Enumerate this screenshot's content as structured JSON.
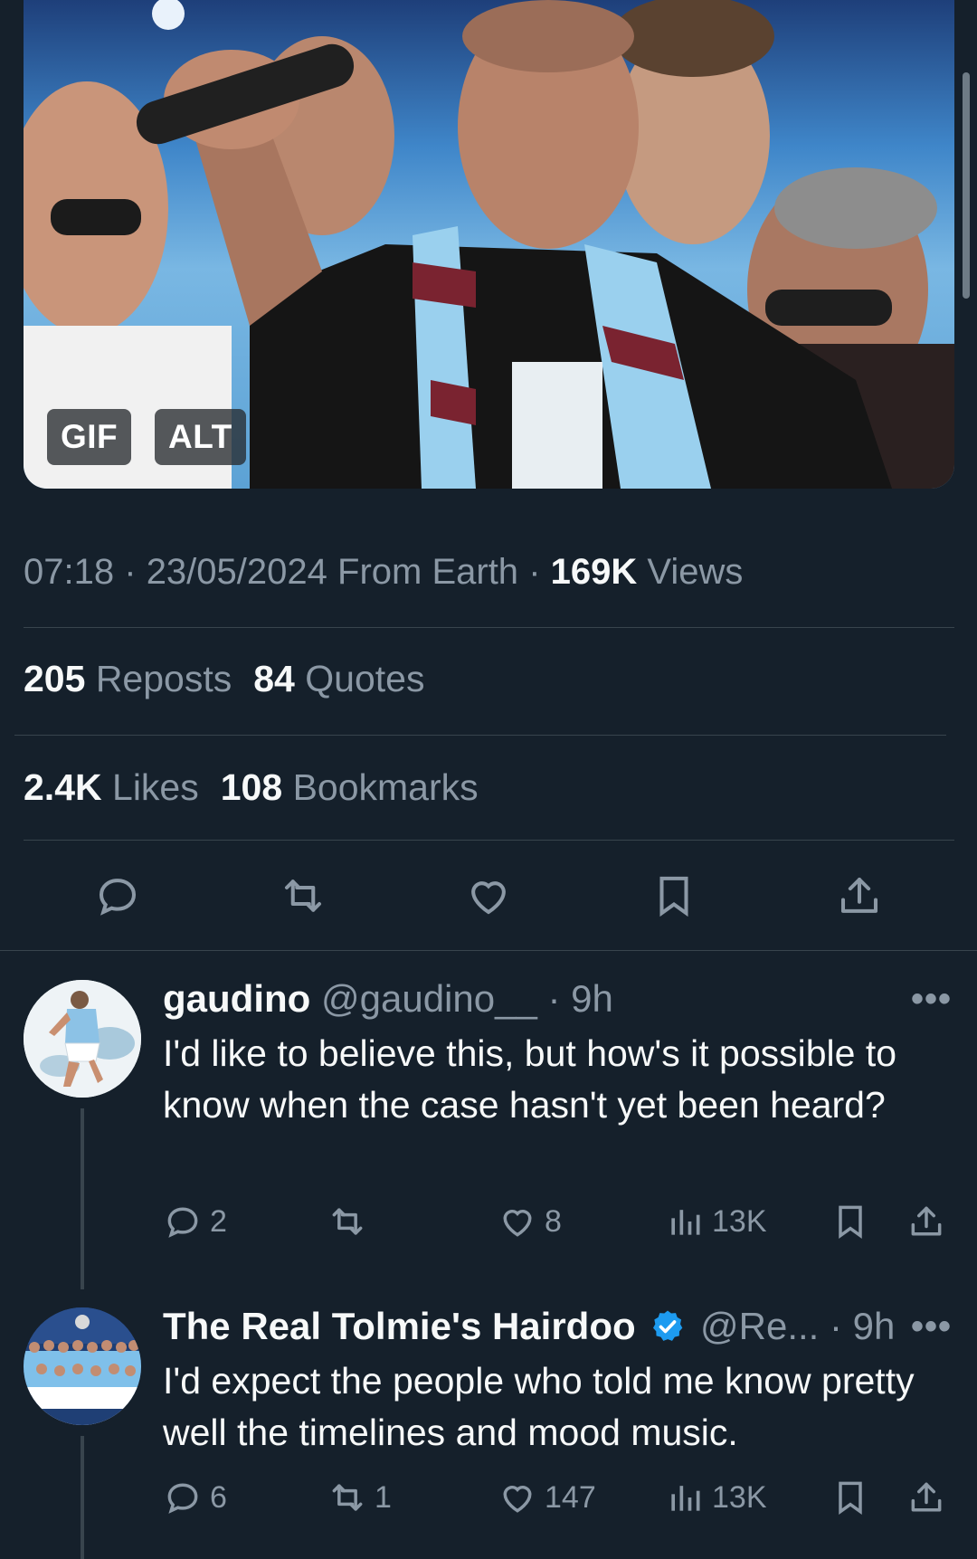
{
  "media": {
    "badge_gif": "GIF",
    "badge_alt": "ALT"
  },
  "meta": {
    "time": "07:18",
    "sep1": "·",
    "date": "23/05/2024",
    "source": "From Earth",
    "sep2": "·",
    "views_count": "169K",
    "views_label": "Views"
  },
  "stats": {
    "reposts_count": "205",
    "reposts_label": "Reposts",
    "quotes_count": "84",
    "quotes_label": "Quotes",
    "likes_count": "2.4K",
    "likes_label": "Likes",
    "bookmarks_count": "108",
    "bookmarks_label": "Bookmarks"
  },
  "actions": [
    "reply-icon",
    "repost-icon",
    "like-icon",
    "bookmark-icon",
    "share-icon"
  ],
  "replies": [
    {
      "name": "gaudino",
      "handle": "@gaudino__",
      "time": "· 9h",
      "more": "•••",
      "text": "I'd like to believe this, but how's it possible to know when the case hasn't yet been heard?",
      "reply_count": "2",
      "repost_count": "",
      "like_count": "8",
      "views": "13K"
    },
    {
      "name": "The Real Tolmie's Hairdoo",
      "handle": "@Re...",
      "time": "· 9h",
      "more": "•••",
      "text": "I'd expect the people who told me know pretty well the timelines and mood music.",
      "reply_count": "6",
      "repost_count": "1",
      "like_count": "147",
      "views": "13K"
    }
  ],
  "colors": {
    "background": "#15202b",
    "muted": "#8b98a5",
    "text": "#f7f9f9",
    "verified": "#1d9bf0"
  }
}
